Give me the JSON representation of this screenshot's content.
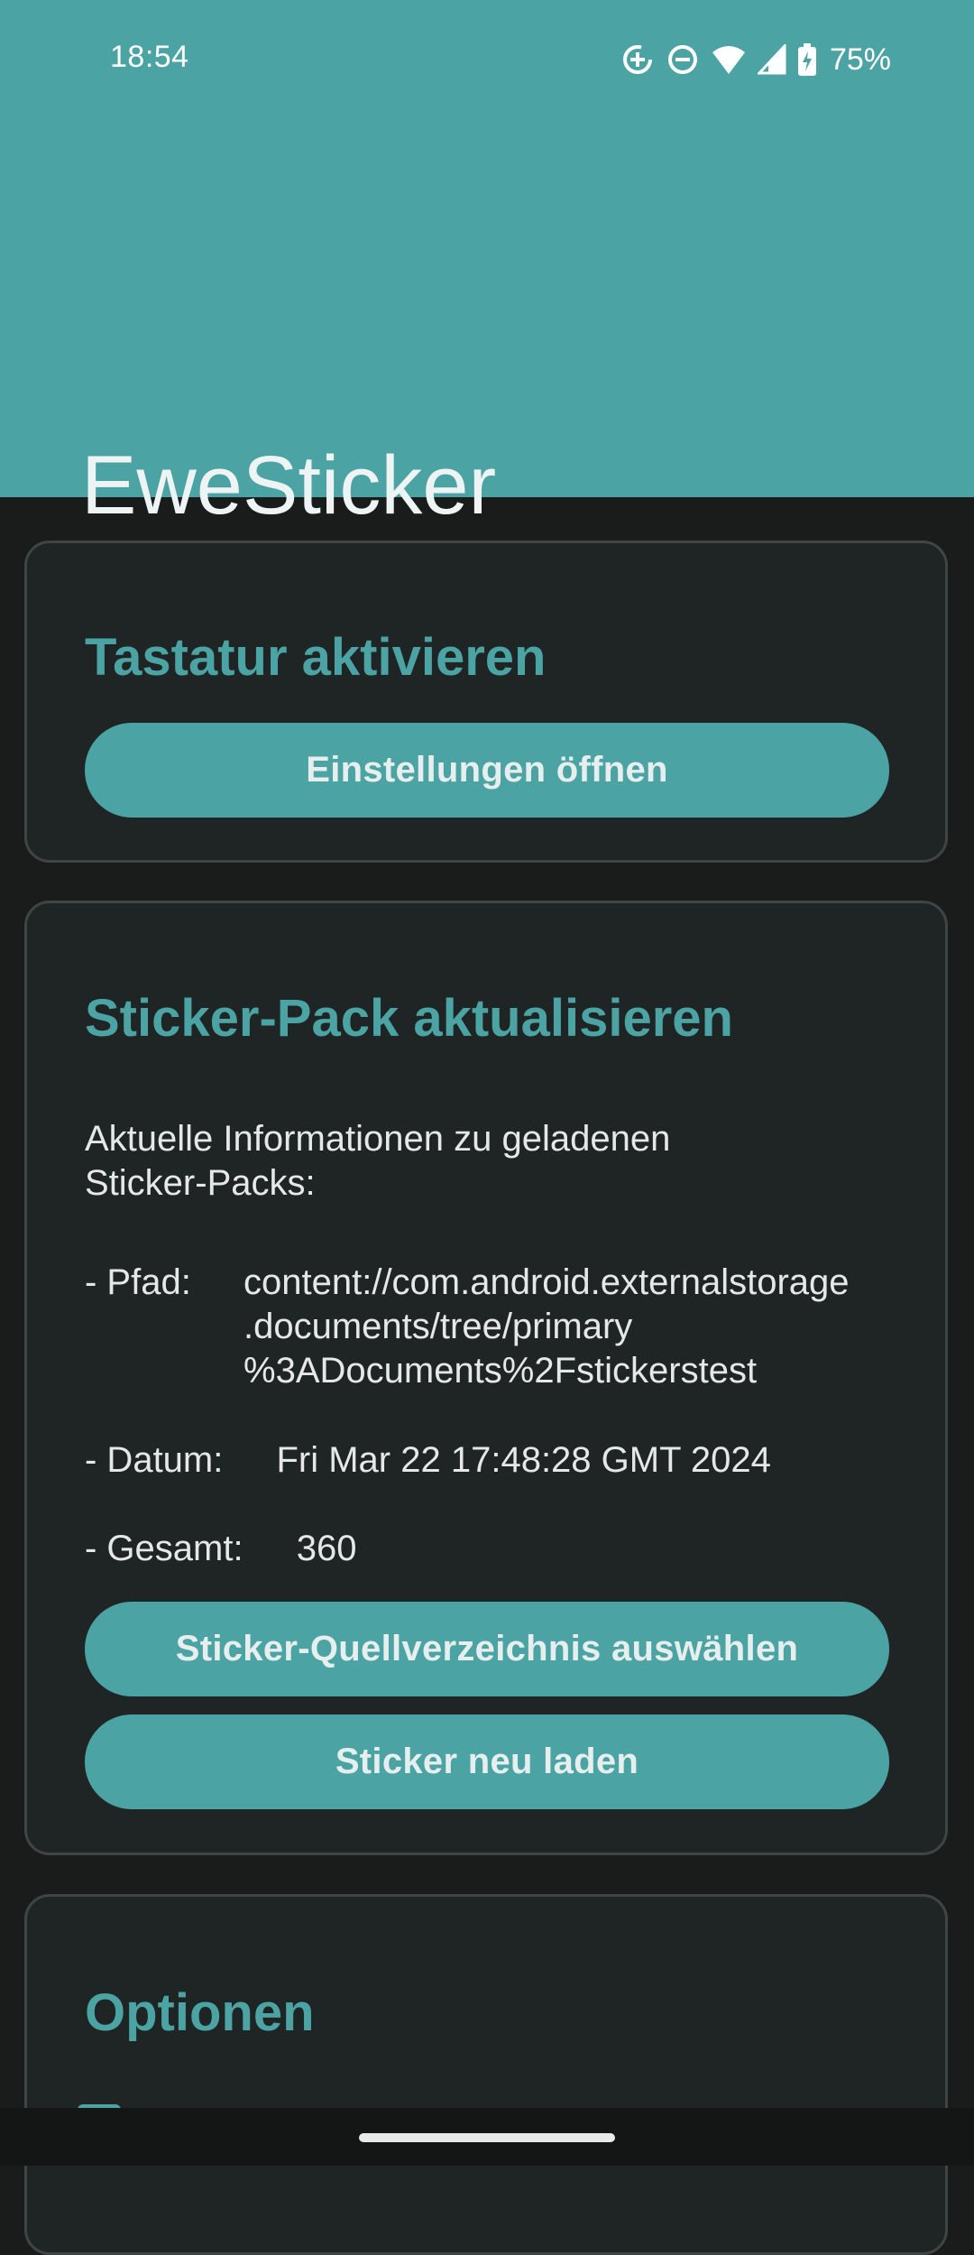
{
  "status_bar": {
    "time": "18:54",
    "battery": "75%",
    "icons": [
      "data-saver-icon",
      "do-not-disturb-icon",
      "wifi-icon",
      "signal-icon",
      "battery-charging-icon"
    ]
  },
  "app_bar": {
    "title": "EweSticker",
    "background_color": "#4ba3a3"
  },
  "keyboard_card": {
    "title": "Tastatur aktivieren",
    "settings_button": "Einstellungen öffnen"
  },
  "sticker_pack_card": {
    "title": "Sticker-Pack aktualisieren",
    "intro": "Aktuelle Informationen zu geladenen Sticker-Packs:",
    "path_label": "- Pfad:",
    "path_value": "content://com.android.externalstorage\n.documents/tree/primary\n%3ADocuments%2Fstickerstest",
    "date_label": "- Datum:",
    "date_value": "Fri Mar 22 17:48:28 GMT 2024",
    "total_label": "- Gesamt:",
    "total_value": "360",
    "choose_dir_button": "Sticker-Quellverzeichnis auswählen",
    "reload_button": "Sticker neu laden"
  },
  "options_card": {
    "title": "Optionen"
  },
  "accent_color": "#4ba3a3"
}
